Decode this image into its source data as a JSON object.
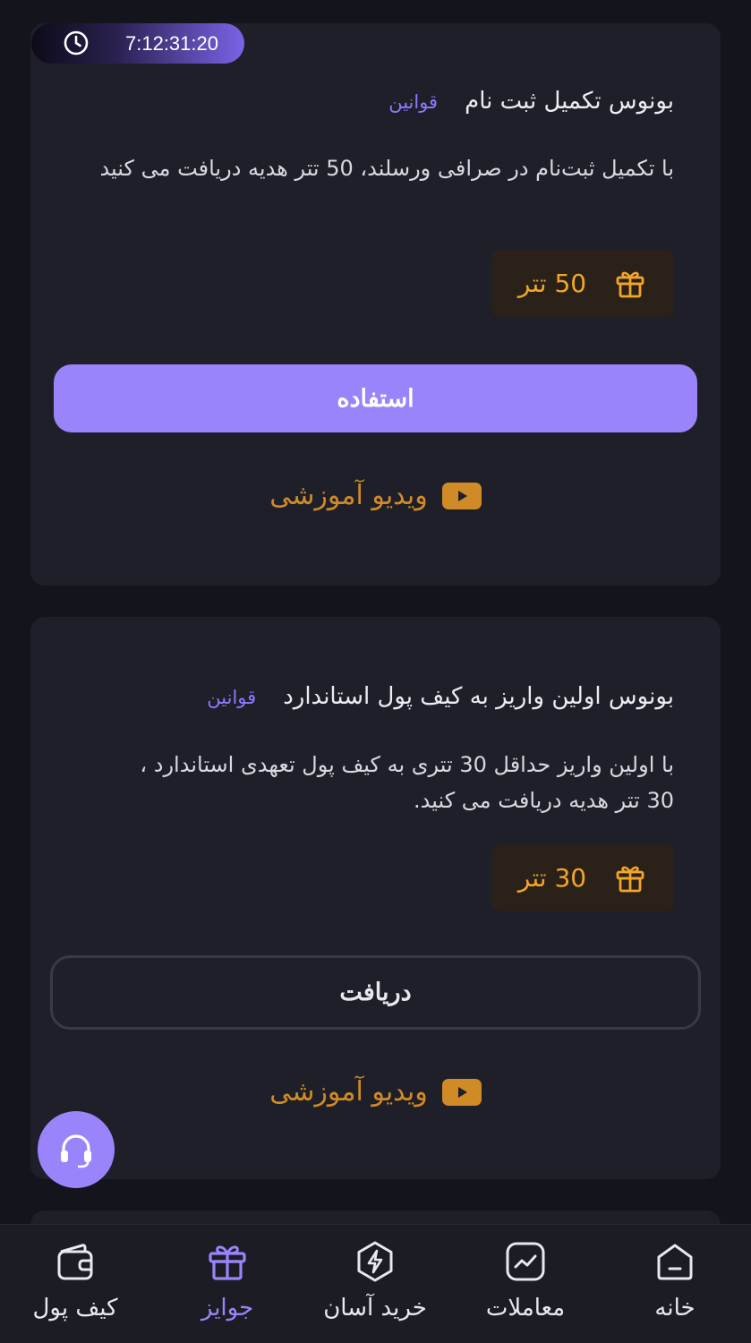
{
  "timer": {
    "time": "7:12:31:20",
    "icon": "clock-icon"
  },
  "cards": [
    {
      "title": "بونوس تکمیل ثبت نام",
      "rules_label": "قوانین",
      "description": "با تکمیل ثبت‌نام در صرافی ورسلند، 50 تتر هدیه دریافت می کنید",
      "reward": "50 تتر",
      "reward_icon": "gift-icon",
      "button_label": "استفاده",
      "video_label": "ویدیو آموزشی",
      "video_icon": "youtube-play-icon"
    },
    {
      "title": "بونوس اولین واریز به کیف پول استاندارد",
      "rules_label": "قوانین",
      "description": "با اولین واریز حداقل 30 تتری به کیف پول تعهدی استاندارد ، 30 تتر هدیه دریافت می کنید.",
      "reward": "30 تتر",
      "reward_icon": "gift-icon",
      "button_label": "دریافت",
      "video_label": "ویدیو آموزشی",
      "video_icon": "youtube-play-icon"
    }
  ],
  "support": {
    "icon": "headset-icon"
  },
  "nav": {
    "items": [
      {
        "label": "خانه",
        "icon": "home-icon",
        "active": false
      },
      {
        "label": "معاملات",
        "icon": "chart-icon",
        "active": false
      },
      {
        "label": "خرید آسان",
        "icon": "lightning-icon",
        "active": false
      },
      {
        "label": "جوایز",
        "icon": "gift-icon",
        "active": true
      },
      {
        "label": "کیف پول",
        "icon": "wallet-icon",
        "active": false
      }
    ]
  },
  "colors": {
    "accent": "#9b84fb",
    "reward": "#f3a42b",
    "video": "#d08b26",
    "background": "#14141c",
    "card": "#1f1f29"
  }
}
